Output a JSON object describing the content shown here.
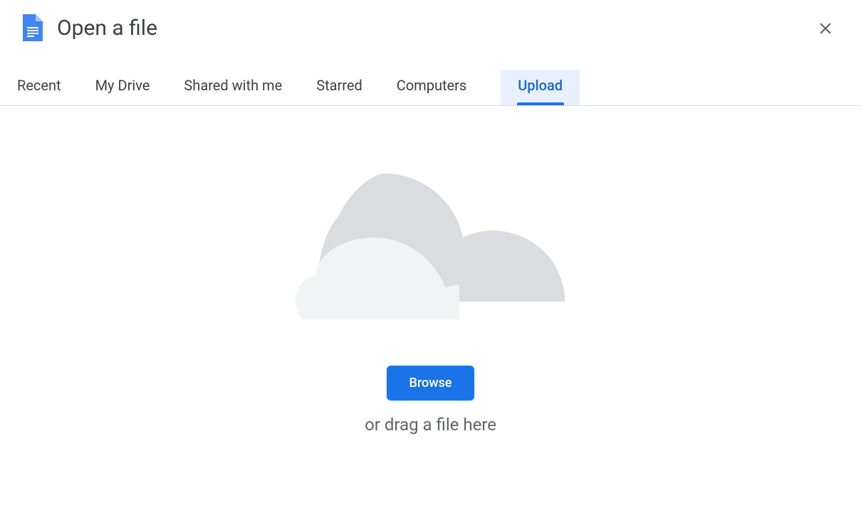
{
  "header": {
    "title": "Open a file"
  },
  "tabs": {
    "items": [
      {
        "label": "Recent",
        "active": false
      },
      {
        "label": "My Drive",
        "active": false
      },
      {
        "label": "Shared with me",
        "active": false
      },
      {
        "label": "Starred",
        "active": false
      },
      {
        "label": "Computers",
        "active": false
      },
      {
        "label": "Upload",
        "active": true
      }
    ]
  },
  "upload": {
    "browse_label": "Browse",
    "drag_text": "or drag a file here"
  }
}
